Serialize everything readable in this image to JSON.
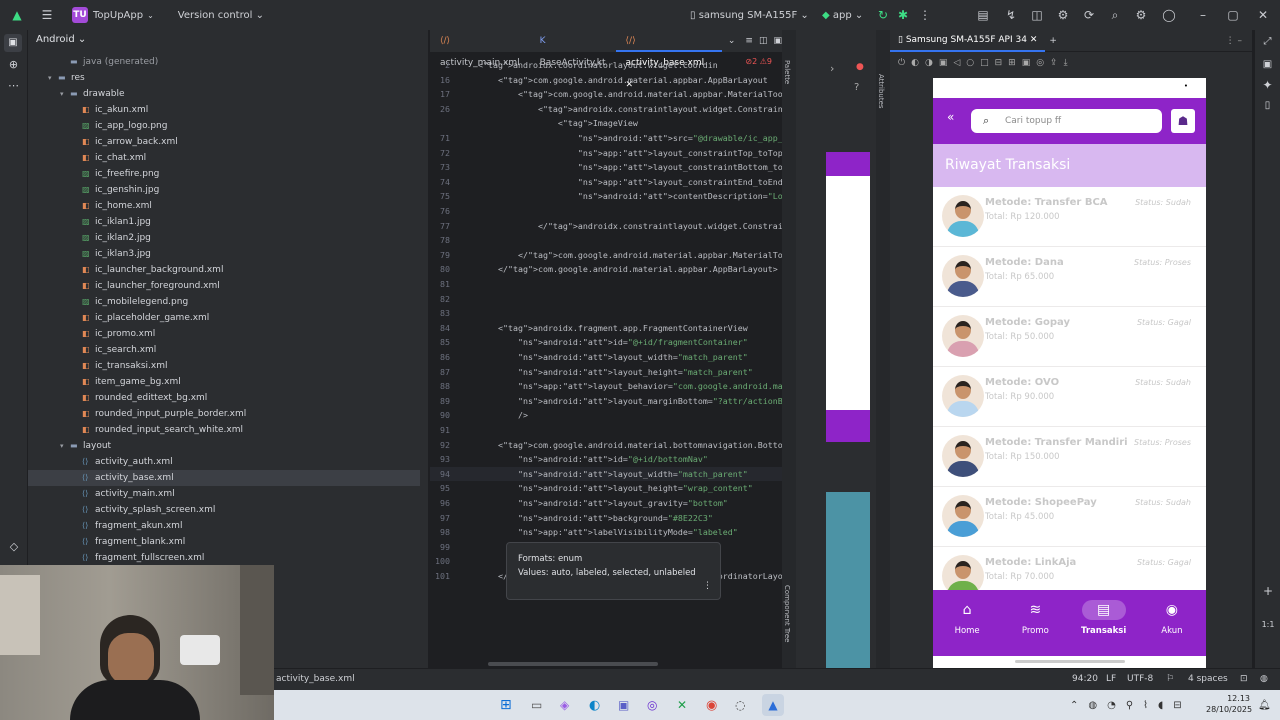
{
  "titlebar": {
    "project_badge": "TU",
    "project": "TopUpApp",
    "vcs": "Version control",
    "device": "samsung SM-A155F",
    "run_config": "app"
  },
  "project_panel": {
    "view": "Android",
    "rows": [
      {
        "label": "java (generated)",
        "depth": 2,
        "kind": "folder",
        "arrow": ""
      },
      {
        "label": "res",
        "depth": 1,
        "kind": "folder",
        "arrow": "▾"
      },
      {
        "label": "drawable",
        "depth": 2,
        "kind": "folder",
        "arrow": "▾"
      },
      {
        "label": "ic_akun.xml",
        "depth": 3,
        "kind": "xml",
        "arrow": ""
      },
      {
        "label": "ic_app_logo.png",
        "depth": 3,
        "kind": "img",
        "arrow": ""
      },
      {
        "label": "ic_arrow_back.xml",
        "depth": 3,
        "kind": "xml",
        "arrow": ""
      },
      {
        "label": "ic_chat.xml",
        "depth": 3,
        "kind": "xml",
        "arrow": ""
      },
      {
        "label": "ic_freefire.png",
        "depth": 3,
        "kind": "img",
        "arrow": ""
      },
      {
        "label": "ic_genshin.jpg",
        "depth": 3,
        "kind": "img",
        "arrow": ""
      },
      {
        "label": "ic_home.xml",
        "depth": 3,
        "kind": "xml",
        "arrow": ""
      },
      {
        "label": "ic_iklan1.jpg",
        "depth": 3,
        "kind": "img",
        "arrow": ""
      },
      {
        "label": "ic_iklan2.jpg",
        "depth": 3,
        "kind": "img",
        "arrow": ""
      },
      {
        "label": "ic_iklan3.jpg",
        "depth": 3,
        "kind": "img",
        "arrow": ""
      },
      {
        "label": "ic_launcher_background.xml",
        "depth": 3,
        "kind": "xml",
        "arrow": ""
      },
      {
        "label": "ic_launcher_foreground.xml",
        "depth": 3,
        "kind": "xml",
        "arrow": ""
      },
      {
        "label": "ic_mobilelegend.png",
        "depth": 3,
        "kind": "img",
        "arrow": ""
      },
      {
        "label": "ic_placeholder_game.xml",
        "depth": 3,
        "kind": "xml",
        "arrow": ""
      },
      {
        "label": "ic_promo.xml",
        "depth": 3,
        "kind": "xml",
        "arrow": ""
      },
      {
        "label": "ic_search.xml",
        "depth": 3,
        "kind": "xml",
        "arrow": ""
      },
      {
        "label": "ic_transaksi.xml",
        "depth": 3,
        "kind": "xml",
        "arrow": ""
      },
      {
        "label": "item_game_bg.xml",
        "depth": 3,
        "kind": "xml",
        "arrow": ""
      },
      {
        "label": "rounded_edittext_bg.xml",
        "depth": 3,
        "kind": "xml",
        "arrow": ""
      },
      {
        "label": "rounded_input_purple_border.xml",
        "depth": 3,
        "kind": "xml",
        "arrow": ""
      },
      {
        "label": "rounded_input_search_white.xml",
        "depth": 3,
        "kind": "xml",
        "arrow": ""
      },
      {
        "label": "layout",
        "depth": 2,
        "kind": "folder",
        "arrow": "▾"
      },
      {
        "label": "activity_auth.xml",
        "depth": 3,
        "kind": "layout",
        "arrow": ""
      },
      {
        "label": "activity_base.xml",
        "depth": 3,
        "kind": "layout",
        "arrow": "",
        "selected": true
      },
      {
        "label": "activity_main.xml",
        "depth": 3,
        "kind": "layout",
        "arrow": ""
      },
      {
        "label": "activity_splash_screen.xml",
        "depth": 3,
        "kind": "layout",
        "arrow": ""
      },
      {
        "label": "fragment_akun.xml",
        "depth": 3,
        "kind": "layout",
        "arrow": ""
      },
      {
        "label": "fragment_blank.xml",
        "depth": 3,
        "kind": "layout",
        "arrow": ""
      },
      {
        "label": "fragment_fullscreen.xml",
        "depth": 3,
        "kind": "layout",
        "arrow": ""
      }
    ]
  },
  "editor": {
    "tabs": [
      {
        "label": "activity_main.xml",
        "active": false
      },
      {
        "label": "BaseActivity.kt",
        "active": false
      },
      {
        "label": "activity_base.xml",
        "active": true
      }
    ],
    "problems": "2  ⚠9",
    "lines": [
      {
        "n": "2",
        "t": "<androidx.coordinatorlayout.widget.Coordin"
      },
      {
        "n": "16",
        "t": "    <com.google.android.material.appbar.AppBarLayout"
      },
      {
        "n": "17",
        "t": "        <com.google.android.material.appbar.MaterialTool"
      },
      {
        "n": "26",
        "t": "            <androidx.constraintlayout.widget.Constraint"
      },
      {
        "n": "",
        "t": "                <ImageView"
      },
      {
        "n": "71",
        "t": "                    android:src=\"@drawable/ic_app_logo\""
      },
      {
        "n": "72",
        "t": "                    app:layout_constraintTop_toTopOf=\"paren"
      },
      {
        "n": "73",
        "t": "                    app:layout_constraintBottom_toBottomOf="
      },
      {
        "n": "74",
        "t": "                    app:layout_constraintEnd_toEndOf=\"paren"
      },
      {
        "n": "75",
        "t": "                    android:contentDescription=\"Logo Aplika"
      },
      {
        "n": "76",
        "t": ""
      },
      {
        "n": "77",
        "t": "            </androidx.constraintlayout.widget.ConstraintLa"
      },
      {
        "n": "78",
        "t": ""
      },
      {
        "n": "79",
        "t": "        </com.google.android.material.appbar.MaterialToolba"
      },
      {
        "n": "80",
        "t": "    </com.google.android.material.appbar.AppBarLayout>"
      },
      {
        "n": "81",
        "t": ""
      },
      {
        "n": "82",
        "t": ""
      },
      {
        "n": "83",
        "t": ""
      },
      {
        "n": "84",
        "t": "    <androidx.fragment.app.FragmentContainerView"
      },
      {
        "n": "85",
        "t": "        android:id=\"@+id/fragmentContainer\""
      },
      {
        "n": "86",
        "t": "        android:layout_width=\"match_parent\""
      },
      {
        "n": "87",
        "t": "        android:layout_height=\"match_parent\""
      },
      {
        "n": "88",
        "t": "        app:layout_behavior=\"com.google.android.material.ap"
      },
      {
        "n": "89",
        "t": "        android:layout_marginBottom=\"?attr/actionBarSize\""
      },
      {
        "n": "90",
        "t": "        />"
      },
      {
        "n": "91",
        "t": ""
      },
      {
        "n": "92",
        "t": "    <com.google.android.material.bottomnavigation.BottomNav"
      },
      {
        "n": "93",
        "t": "        android:id=\"@+id/bottomNav\""
      },
      {
        "n": "94",
        "t": "        android:layout_width=\"match_parent\""
      },
      {
        "n": "95",
        "t": "        android:layout_height=\"wrap_content\""
      },
      {
        "n": "96",
        "t": "        android:layout_gravity=\"bottom\""
      },
      {
        "n": "97",
        "t": "        android:background=\"#8E22C3\""
      },
      {
        "n": "98",
        "t": "        app:labelVisibilityMode=\"labeled\""
      },
      {
        "n": "99",
        "t": ""
      },
      {
        "n": "100",
        "t": ""
      },
      {
        "n": "101",
        "t": "    </androidx.coordinatorlayout.widget.CoordinatorLayout>"
      }
    ],
    "tooltip": {
      "formats": "Formats: enum",
      "values": "Values: auto, labeled, selected, unlabeled"
    }
  },
  "side_labels": {
    "palette": "Palette",
    "attributes": "Attributes",
    "component_tree": "Component Tree"
  },
  "emulator": {
    "title": "Samsung SM-A155F API 34"
  },
  "app": {
    "search_placeholder": "Cari topup ff",
    "header": "Riwayat Transaksi",
    "transactions": [
      {
        "method": "Metode: Transfer BCA",
        "total": "Total: Rp 120.000",
        "status": "Status: Sudah",
        "shirt": "#5bb7d6"
      },
      {
        "method": "Metode: Dana",
        "total": "Total: Rp 65.000",
        "status": "Status: Proses",
        "shirt": "#4a5b8c"
      },
      {
        "method": "Metode: Gopay",
        "total": "Total: Rp 50.000",
        "status": "Status: Gagal",
        "shirt": "#d9a0b0"
      },
      {
        "method": "Metode: OVO",
        "total": "Total: Rp 90.000",
        "status": "Status: Sudah",
        "shirt": "#b9d6ef"
      },
      {
        "method": "Metode: Transfer Mandiri",
        "total": "Total: Rp 150.000",
        "status": "Status: Proses",
        "shirt": "#3e4f7a"
      },
      {
        "method": "Metode: ShopeePay",
        "total": "Total: Rp 45.000",
        "status": "Status: Sudah",
        "shirt": "#4a9ed6"
      },
      {
        "method": "Metode: LinkAja",
        "total": "Total: Rp 70.000",
        "status": "Status: Gagal",
        "shirt": "#6fb04a"
      }
    ],
    "nav": [
      {
        "label": "Home",
        "icon": "⌂"
      },
      {
        "label": "Promo",
        "icon": "≋"
      },
      {
        "label": "Transaksi",
        "icon": "▤",
        "active": true
      },
      {
        "label": "Akun",
        "icon": "◉"
      }
    ],
    "colors": {
      "primary": "#8e24c8",
      "header": "#d8b8f0"
    }
  },
  "statusbar": {
    "file": "activity_base.xml",
    "pos": "94:20",
    "eol": "LF",
    "enc": "UTF-8",
    "indent": "4 spaces"
  },
  "taskbar": {
    "time": "12.13",
    "date": "28/10/2025"
  }
}
